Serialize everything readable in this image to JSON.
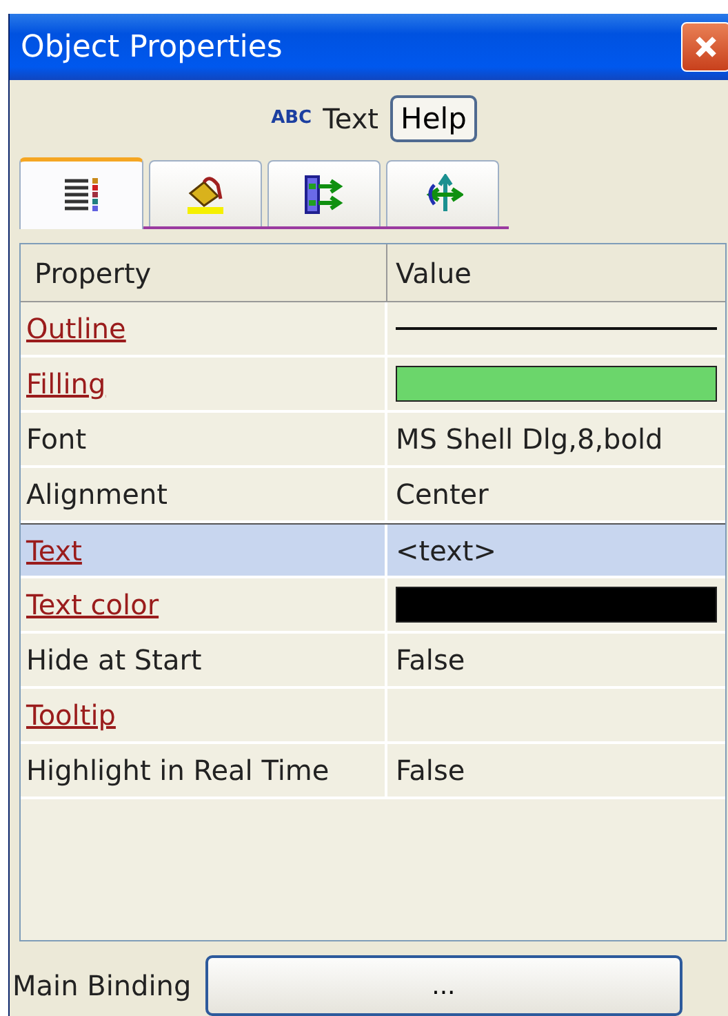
{
  "window": {
    "title": "Object Properties"
  },
  "object": {
    "badge": "ABC",
    "type_label": "Text",
    "help_button": "Help"
  },
  "tabs": [
    {
      "kind": "list",
      "selected": true
    },
    {
      "kind": "paint",
      "selected": false
    },
    {
      "kind": "connect",
      "selected": false
    },
    {
      "kind": "move",
      "selected": false
    }
  ],
  "table": {
    "columns": [
      "Property",
      "Value"
    ],
    "rows": [
      {
        "property": "Outline",
        "linked": true,
        "selected": false,
        "kind": "line"
      },
      {
        "property": "Filling",
        "linked": true,
        "selected": false,
        "kind": "swatch",
        "color": "#6bd66b"
      },
      {
        "property": "Font",
        "linked": false,
        "selected": false,
        "kind": "text",
        "value": "MS Shell Dlg,8,bold"
      },
      {
        "property": "Alignment",
        "linked": false,
        "selected": false,
        "kind": "text",
        "value": "Center"
      },
      {
        "property": "Text",
        "linked": true,
        "selected": true,
        "kind": "text",
        "value": "<text>"
      },
      {
        "property": "Text color",
        "linked": true,
        "selected": false,
        "kind": "swatch",
        "color": "#000000"
      },
      {
        "property": "Hide at Start",
        "linked": false,
        "selected": false,
        "kind": "text",
        "value": "False"
      },
      {
        "property": "Tooltip",
        "linked": true,
        "selected": false,
        "kind": "empty"
      },
      {
        "property": "Highlight in Real Time",
        "linked": false,
        "selected": false,
        "kind": "text",
        "value": "False"
      }
    ]
  },
  "main_binding": {
    "label": "Main Binding",
    "button": "..."
  }
}
